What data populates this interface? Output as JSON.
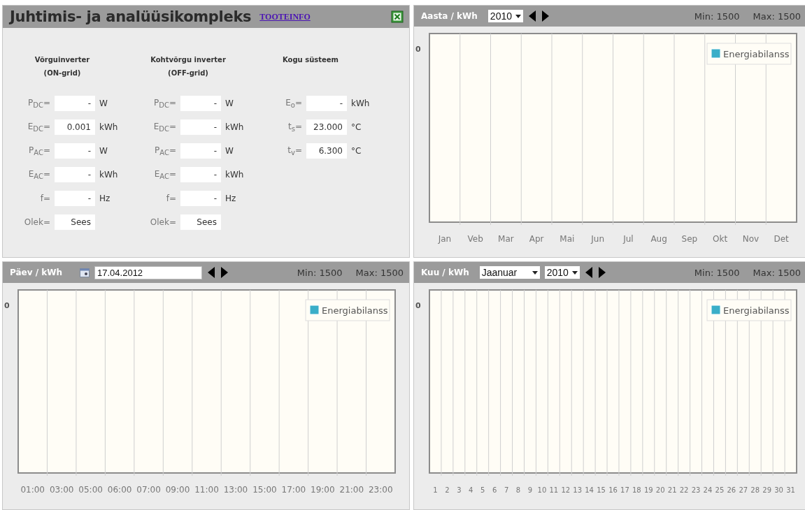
{
  "control_panel": {
    "title": "Juhtimis- ja analüüsikompleks",
    "link": "TOOTEINFO",
    "columns": [
      {
        "heading": [
          "Võrguinverter",
          "(ON-grid)"
        ],
        "rows": [
          {
            "label": "P$_{DC}$=",
            "value": "-",
            "unit": "W"
          },
          {
            "label": "E$_{DC}$=",
            "value": "0.001",
            "unit": "kWh"
          },
          {
            "label": "P$_{AC}$=",
            "value": "-",
            "unit": "W"
          },
          {
            "label": "E$_{AC}$=",
            "value": "-",
            "unit": "kWh"
          },
          {
            "label": "f=",
            "value": "-",
            "unit": "Hz"
          },
          {
            "label": "Olek=",
            "value": "Sees",
            "unit": ""
          }
        ]
      },
      {
        "heading": [
          "Kohtvõrgu inverter",
          "(OFF-grid)"
        ],
        "rows": [
          {
            "label": "P$_{DC}$=",
            "value": "-",
            "unit": "W"
          },
          {
            "label": "E$_{DC}$=",
            "value": "-",
            "unit": "kWh"
          },
          {
            "label": "P$_{AC}$=",
            "value": "-",
            "unit": "W"
          },
          {
            "label": "E$_{AC}$=",
            "value": "-",
            "unit": "kWh"
          },
          {
            "label": "f=",
            "value": "-",
            "unit": "Hz"
          },
          {
            "label": "Olek=",
            "value": "Sees",
            "unit": ""
          }
        ]
      },
      {
        "heading": [
          "Kogu süsteem"
        ],
        "rows": [
          {
            "label": "E$_{o}$=",
            "value": "-",
            "unit": "kWh"
          },
          {
            "label": "t$_{s}$=",
            "value": "23.000",
            "unit": "°C"
          },
          {
            "label": "t$_{v}$=",
            "value": "6.300",
            "unit": "°C"
          }
        ]
      }
    ]
  },
  "year_panel": {
    "title": "Aasta / kWh",
    "selects": [
      {
        "value": "2010"
      }
    ],
    "min": "Min: 1500",
    "max": "Max: 1500",
    "chart": {
      "y_label": "0",
      "x_labels": [
        "Jan",
        "Veb",
        "Mar",
        "Apr",
        "Mai",
        "Jun",
        "Jul",
        "Aug",
        "Sep",
        "Okt",
        "Nov",
        "Det"
      ],
      "legend": {
        "name": "Energiabilanss",
        "color": "#3aaec8"
      }
    }
  },
  "day_panel": {
    "title": "Päev / kWh",
    "date": "17.04.2012",
    "min": "Min: 1500",
    "max": "Max: 1500",
    "chart": {
      "y_label": "0",
      "x_labels": [
        "01:00",
        "03:00",
        "05:00",
        "06:00",
        "07:00",
        "09:00",
        "11:00",
        "13:00",
        "15:00",
        "17:00",
        "19:00",
        "21:00",
        "23:00"
      ],
      "legend": {
        "name": "Energiabilanss",
        "color": "#3aaec8"
      }
    }
  },
  "month_panel": {
    "title": "Kuu / kWh",
    "selects": [
      {
        "value": "Jaanuar"
      },
      {
        "value": "2010"
      }
    ],
    "min": "Min: 1500",
    "max": "Max: 1500",
    "chart": {
      "y_label": "0",
      "x_labels": [
        "1",
        "2",
        "3",
        "4",
        "5",
        "6",
        "7",
        "8",
        "9",
        "10",
        "11",
        "12",
        "13",
        "14",
        "15",
        "16",
        "17",
        "18",
        "19",
        "20",
        "21",
        "22",
        "23",
        "24",
        "25",
        "26",
        "27",
        "28",
        "29",
        "30",
        "31"
      ],
      "legend": {
        "name": "Energiabilanss",
        "color": "#3aaec8"
      }
    }
  }
}
